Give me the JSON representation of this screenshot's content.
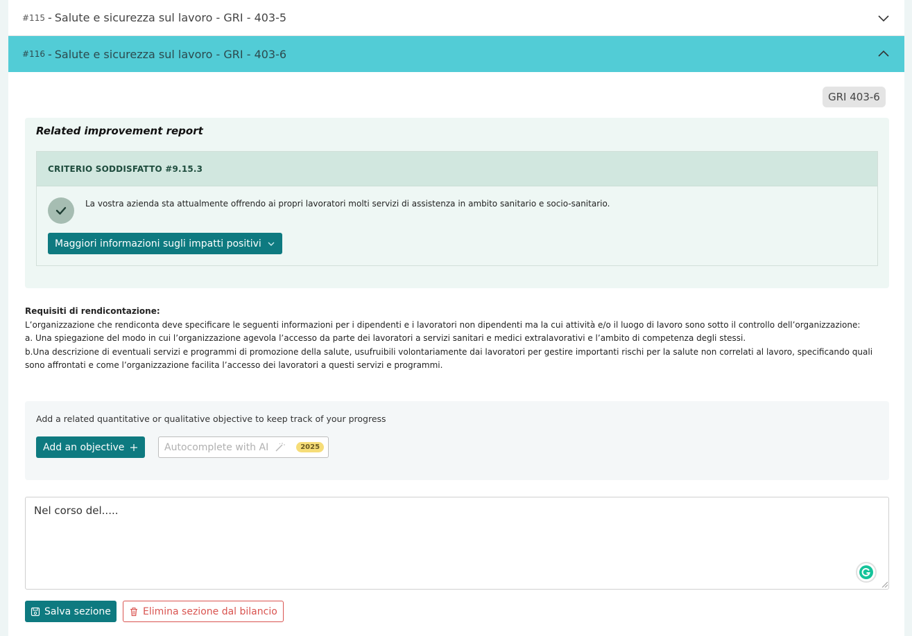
{
  "accordion": [
    {
      "number": "#115",
      "separator": "-",
      "title": "Salute e sicurezza sul lavoro - GRI - 403-5",
      "icon": "chevron-down-icon"
    },
    {
      "number": "#116",
      "separator": "-",
      "title": "Salute e sicurezza sul lavoro - GRI - 403-6",
      "icon": "chevron-up-icon"
    }
  ],
  "gri_badge": "GRI 403-6",
  "improvement": {
    "title": "Related improvement report",
    "criterio_title": "CRITERIO SODDISFATTO #9.15.3",
    "text": "La vostra azienda sta attualmente offrendo ai propri lavoratori molti servizi di assistenza in ambito sanitario e socio-sanitario.",
    "more_button": "Maggiori informazioni sugli impatti positivi"
  },
  "requisiti": {
    "title": "Requisiti di rendicontazione:",
    "lines": [
      "L’organizzazione che rendiconta deve specificare le seguenti informazioni per i dipendenti e i lavoratori non dipendenti ma la cui attività e/o il luogo di lavoro sono sotto il controllo dell’organizzazione:",
      "a. Una spiegazione del modo in cui l’organizzazione agevola l’accesso da parte dei lavoratori a servizi sanitari e medici extralavorativi e l’ambito di competenza degli stessi.",
      "b.Una descrizione di eventuali servizi e programmi di promozione della salute, usufruibili volontariamente dai lavoratori per gestire importanti rischi per la salute non correlati al lavoro, specificando quali sono affrontati e come l’organizzazione facilita l’accesso dei lavoratori a questi servizi e programmi."
    ]
  },
  "objective": {
    "hint": "Add a related quantitative or qualitative objective to keep track of your progress",
    "add_button": "Add an objective",
    "ai_button": "Autocomplete with AI",
    "year_badge": "2025"
  },
  "editor": {
    "value": "Nel corso del....."
  },
  "actions": {
    "save": "Salva sezione",
    "delete": "Elimina sezione dal bilancio"
  },
  "colors": {
    "accent": "#0e7a80",
    "active_header": "#52ccd6",
    "danger": "#d9534f",
    "badge_yellow": "#f6dd78"
  }
}
